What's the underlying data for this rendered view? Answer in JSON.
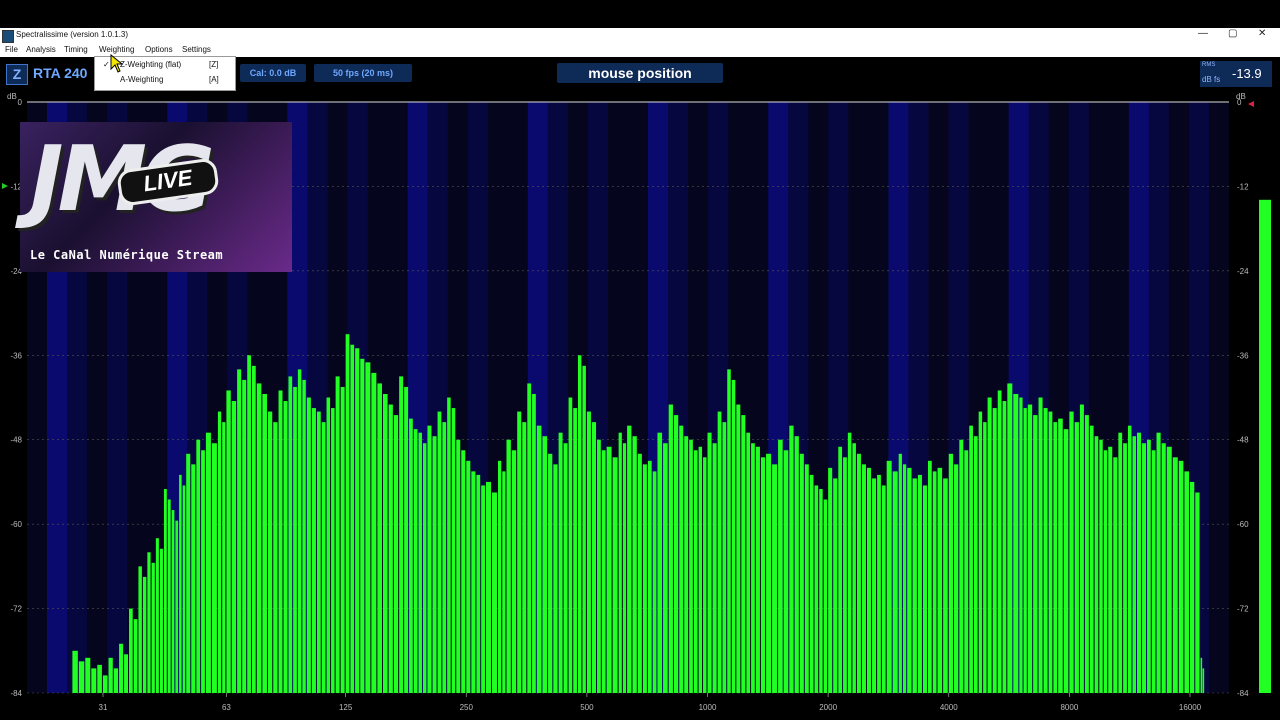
{
  "window": {
    "title": "Spectralissime (version 1.0.1.3)",
    "controls": {
      "minimize": "—",
      "maximize": "▢",
      "close": "✕"
    }
  },
  "menu": [
    "File",
    "Analysis",
    "Timing",
    "Weighting",
    "Options",
    "Settings"
  ],
  "weighting_menu": {
    "items": [
      {
        "label": "Z-Weighting (flat)",
        "shortcut": "[Z]",
        "checked": true
      },
      {
        "label": "A-Weighting",
        "shortcut": "[A]",
        "checked": false
      }
    ]
  },
  "toolbar": {
    "weighting_badge": "Z",
    "mode": "RTA 240",
    "cal": "Cal:  0.0 dB",
    "fps": "50 fps (20 ms)",
    "mouse_position": "mouse position",
    "rms_label": "RMS",
    "dbfs_label": "dB fs",
    "rms_value": "-13.9"
  },
  "logo": {
    "word": "JMG",
    "live": "LIVE",
    "tagline": "Le CaNal Numérique Stream"
  },
  "colors": {
    "bar": "#22ff22",
    "band_dark": "#05051e",
    "band_blue": "#0a0a6e",
    "accent": "#6ea8ff",
    "panel": "#0e2a57"
  },
  "chart_data": {
    "type": "bar",
    "ylabel_left": "dB",
    "ylabel_right": "dB",
    "ylim": [
      -84,
      0
    ],
    "y_ticks": [
      0,
      -12,
      -24,
      -36,
      -48,
      -60,
      -72,
      -84
    ],
    "x_scale": "log",
    "xlim": [
      20,
      20000
    ],
    "x_ticks": [
      31,
      63,
      125,
      250,
      500,
      1000,
      2000,
      4000,
      8000,
      16000
    ],
    "rms_meter_db": -13.9,
    "bars": [
      {
        "f": 26,
        "db": -78
      },
      {
        "f": 28,
        "db": -79
      },
      {
        "f": 30,
        "db": -80
      },
      {
        "f": 32,
        "db": -79
      },
      {
        "f": 34,
        "db": -77
      },
      {
        "f": 36,
        "db": -72
      },
      {
        "f": 38,
        "db": -66
      },
      {
        "f": 40,
        "db": -64
      },
      {
        "f": 42,
        "db": -62
      },
      {
        "f": 44,
        "db": -55
      },
      {
        "f": 46,
        "db": -58
      },
      {
        "f": 48,
        "db": -53
      },
      {
        "f": 50,
        "db": -50
      },
      {
        "f": 53,
        "db": -48
      },
      {
        "f": 56,
        "db": -47
      },
      {
        "f": 60,
        "db": -44
      },
      {
        "f": 63,
        "db": -41
      },
      {
        "f": 67,
        "db": -38
      },
      {
        "f": 71,
        "db": -36
      },
      {
        "f": 75,
        "db": -40
      },
      {
        "f": 80,
        "db": -44
      },
      {
        "f": 85,
        "db": -41
      },
      {
        "f": 90,
        "db": -39
      },
      {
        "f": 95,
        "db": -38
      },
      {
        "f": 100,
        "db": -42
      },
      {
        "f": 106,
        "db": -44
      },
      {
        "f": 112,
        "db": -42
      },
      {
        "f": 118,
        "db": -39
      },
      {
        "f": 125,
        "db": -33
      },
      {
        "f": 132,
        "db": -35
      },
      {
        "f": 140,
        "db": -37
      },
      {
        "f": 150,
        "db": -40
      },
      {
        "f": 160,
        "db": -43
      },
      {
        "f": 170,
        "db": -39
      },
      {
        "f": 180,
        "db": -45
      },
      {
        "f": 190,
        "db": -47
      },
      {
        "f": 200,
        "db": -46
      },
      {
        "f": 212,
        "db": -44
      },
      {
        "f": 224,
        "db": -42
      },
      {
        "f": 236,
        "db": -48
      },
      {
        "f": 250,
        "db": -51
      },
      {
        "f": 265,
        "db": -53
      },
      {
        "f": 280,
        "db": -54
      },
      {
        "f": 300,
        "db": -51
      },
      {
        "f": 315,
        "db": -48
      },
      {
        "f": 335,
        "db": -44
      },
      {
        "f": 355,
        "db": -40
      },
      {
        "f": 375,
        "db": -46
      },
      {
        "f": 400,
        "db": -50
      },
      {
        "f": 425,
        "db": -47
      },
      {
        "f": 450,
        "db": -42
      },
      {
        "f": 475,
        "db": -36
      },
      {
        "f": 500,
        "db": -44
      },
      {
        "f": 530,
        "db": -48
      },
      {
        "f": 560,
        "db": -49
      },
      {
        "f": 600,
        "db": -47
      },
      {
        "f": 630,
        "db": -46
      },
      {
        "f": 670,
        "db": -50
      },
      {
        "f": 710,
        "db": -51
      },
      {
        "f": 750,
        "db": -47
      },
      {
        "f": 800,
        "db": -43
      },
      {
        "f": 850,
        "db": -46
      },
      {
        "f": 900,
        "db": -48
      },
      {
        "f": 950,
        "db": -49
      },
      {
        "f": 1000,
        "db": -47
      },
      {
        "f": 1060,
        "db": -44
      },
      {
        "f": 1120,
        "db": -38
      },
      {
        "f": 1180,
        "db": -43
      },
      {
        "f": 1250,
        "db": -47
      },
      {
        "f": 1320,
        "db": -49
      },
      {
        "f": 1400,
        "db": -50
      },
      {
        "f": 1500,
        "db": -48
      },
      {
        "f": 1600,
        "db": -46
      },
      {
        "f": 1700,
        "db": -50
      },
      {
        "f": 1800,
        "db": -53
      },
      {
        "f": 1900,
        "db": -55
      },
      {
        "f": 2000,
        "db": -52
      },
      {
        "f": 2120,
        "db": -49
      },
      {
        "f": 2240,
        "db": -47
      },
      {
        "f": 2360,
        "db": -50
      },
      {
        "f": 2500,
        "db": -52
      },
      {
        "f": 2650,
        "db": -53
      },
      {
        "f": 2800,
        "db": -51
      },
      {
        "f": 3000,
        "db": -50
      },
      {
        "f": 3150,
        "db": -52
      },
      {
        "f": 3350,
        "db": -53
      },
      {
        "f": 3550,
        "db": -51
      },
      {
        "f": 3750,
        "db": -52
      },
      {
        "f": 4000,
        "db": -50
      },
      {
        "f": 4250,
        "db": -48
      },
      {
        "f": 4500,
        "db": -46
      },
      {
        "f": 4750,
        "db": -44
      },
      {
        "f": 5000,
        "db": -42
      },
      {
        "f": 5300,
        "db": -41
      },
      {
        "f": 5600,
        "db": -40
      },
      {
        "f": 6000,
        "db": -42
      },
      {
        "f": 6300,
        "db": -43
      },
      {
        "f": 6700,
        "db": -42
      },
      {
        "f": 7100,
        "db": -44
      },
      {
        "f": 7500,
        "db": -45
      },
      {
        "f": 8000,
        "db": -44
      },
      {
        "f": 8500,
        "db": -43
      },
      {
        "f": 9000,
        "db": -46
      },
      {
        "f": 9500,
        "db": -48
      },
      {
        "f": 10000,
        "db": -49
      },
      {
        "f": 10600,
        "db": -47
      },
      {
        "f": 11200,
        "db": -46
      },
      {
        "f": 11800,
        "db": -47
      },
      {
        "f": 12500,
        "db": -48
      },
      {
        "f": 13200,
        "db": -47
      },
      {
        "f": 14000,
        "db": -49
      },
      {
        "f": 15000,
        "db": -51
      },
      {
        "f": 16000,
        "db": -54
      },
      {
        "f": 17000,
        "db": -79
      }
    ]
  }
}
